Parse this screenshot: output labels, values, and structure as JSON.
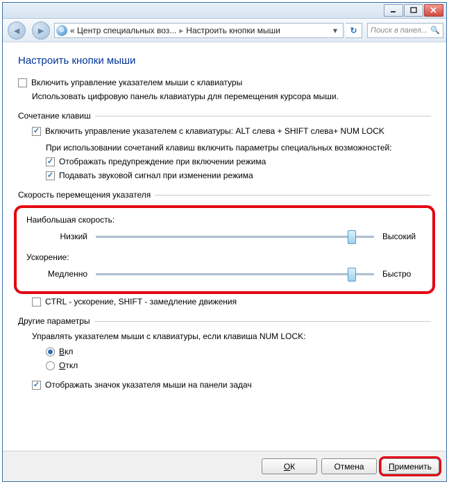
{
  "titlebar": {},
  "breadcrumb": {
    "prefix": "«",
    "part1": "Центр специальных воз...",
    "part2": "Настроить кнопки мыши"
  },
  "search": {
    "placeholder": "Поиск в панел..."
  },
  "page_title": "Настроить кнопки мыши",
  "main_checkbox": {
    "label": "Включить управление указателем мыши с клавиатуры",
    "checked": false
  },
  "main_desc": "Использовать цифровую панель клавиатуры для перемещения курсора мыши.",
  "group1": {
    "title": "Сочетание клавиш",
    "enable_combo": {
      "label": "Включить управление указателем с клавиатуры: ALT слева + SHIFT слева+ NUM LOCK",
      "checked": true
    },
    "desc": "При использовании сочетаний клавиш включить параметры специальных возможностей:",
    "warn": {
      "label": "Отображать предупреждение при включении режима",
      "checked": true
    },
    "sound": {
      "label": "Подавать звуковой сигнал при изменении режима",
      "checked": true
    }
  },
  "group2": {
    "title": "Скорость перемещения указателя",
    "topspeed": {
      "title": "Наибольшая скорость:",
      "low": "Низкий",
      "high": "Высокий",
      "pos": 92
    },
    "accel": {
      "title": "Ускорение:",
      "slow": "Медленно",
      "fast": "Быстро",
      "pos": 92
    },
    "ctrl": {
      "label": "CTRL - ускорение, SHIFT - замедление движения",
      "checked": false
    }
  },
  "group3": {
    "title": "Другие параметры",
    "desc": "Управлять указателем мыши с клавиатуры, если клавиша NUM LOCK:",
    "on": {
      "label": "Вкл",
      "u": "В"
    },
    "off": {
      "label": "Откл",
      "u": "О"
    },
    "tray": {
      "label": "Отображать значок указателя мыши на панели задач",
      "checked": true
    }
  },
  "buttons": {
    "ok": "ОК",
    "ok_u": "О",
    "cancel": "Отмена",
    "apply": "Применить",
    "apply_u": "П"
  },
  "chart_data": null
}
